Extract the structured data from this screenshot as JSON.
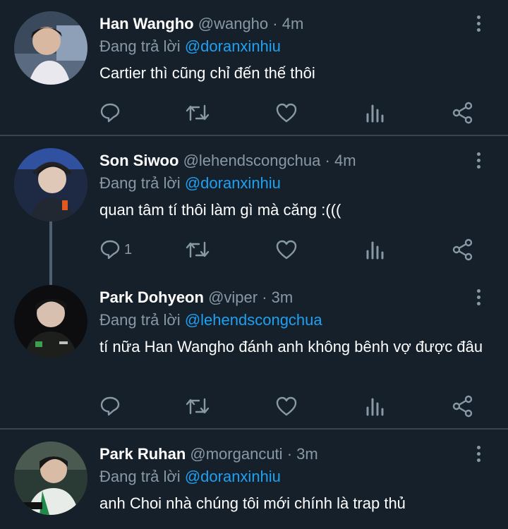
{
  "reply_prefix": "Đang trả lời",
  "tweets": [
    {
      "name": "Han Wangho",
      "handle": "@wangho",
      "time": "4m",
      "reply_to": "@doranxinhiu",
      "text": "Cartier thì cũng chỉ đến thế thôi",
      "reply_count": ""
    },
    {
      "name": "Son Siwoo",
      "handle": "@lehendscongchua",
      "time": "4m",
      "reply_to": "@doranxinhiu",
      "text": "quan tâm tí thôi làm gì mà căng :(((",
      "reply_count": "1"
    },
    {
      "name": "Park Dohyeon",
      "handle": "@viper",
      "time": "3m",
      "reply_to": "@lehendscongchua",
      "text": "tí nữa Han Wangho đánh anh không bênh vợ được đâu",
      "reply_count": ""
    },
    {
      "name": "Park Ruhan",
      "handle": "@morgancuti",
      "time": "3m",
      "reply_to": "@doranxinhiu",
      "text": "anh Choi nhà chúng tôi mới chính là trap thủ",
      "reply_count": ""
    }
  ],
  "dot": "·",
  "icons": [
    "reply-icon",
    "retweet-icon",
    "like-icon",
    "analytics-icon",
    "share-icon",
    "more-icon"
  ],
  "colors": {
    "background": "#15202b",
    "muted": "#8899a6",
    "mention": "#1da1f2",
    "divider": "#38444d"
  }
}
